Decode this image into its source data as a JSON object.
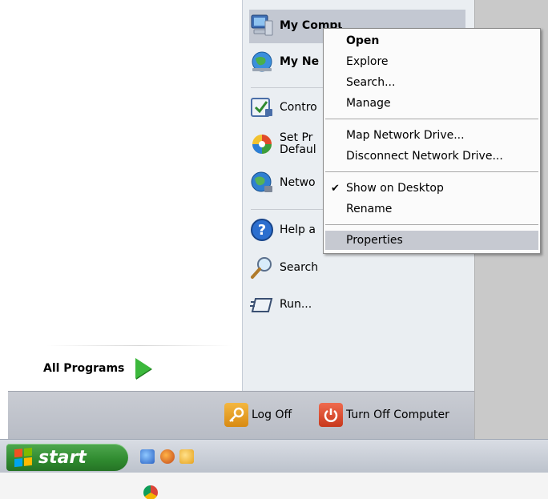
{
  "start_menu": {
    "all_programs": "All Programs",
    "right_items": {
      "my_computer": "My Computer",
      "my_network": "My Ne",
      "control_panel": "Contro",
      "set_program_1": "Set Pr",
      "set_program_2": "Defaul",
      "network": "Netwo",
      "help": "Help a",
      "search": "Search",
      "run": "Run..."
    },
    "bottom": {
      "log_off": "Log Off",
      "turn_off": "Turn Off Computer"
    }
  },
  "taskbar": {
    "start_label": "start"
  },
  "context_menu": {
    "items": [
      {
        "label": "Open",
        "bold": true
      },
      {
        "label": "Explore"
      },
      {
        "label": "Search..."
      },
      {
        "label": "Manage"
      },
      {
        "label": "Map Network Drive..."
      },
      {
        "label": "Disconnect Network Drive..."
      },
      {
        "label": "Show on Desktop",
        "checked": true
      },
      {
        "label": "Rename"
      },
      {
        "label": "Properties",
        "highlighted": true
      }
    ],
    "check_glyph": "✔"
  },
  "colors": {
    "start_green": "#2f8a2f",
    "menu_highlight": "#c6c9d1",
    "right_pane": "#eaeef2"
  }
}
